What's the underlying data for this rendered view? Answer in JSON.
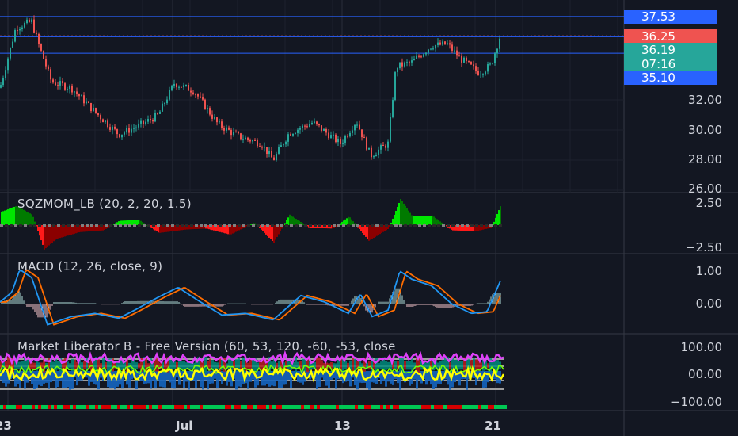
{
  "panes": {
    "price": {
      "axis_labels": [
        "32.00",
        "30.00",
        "28.00",
        "26.00"
      ],
      "tags": [
        {
          "name": "price-tag-high-line",
          "label": "37.53",
          "color": "#2962ff",
          "value": 37.53
        },
        {
          "name": "price-tag-last",
          "label": "36.25",
          "color": "#ef5350",
          "value": 36.25
        },
        {
          "name": "price-tag-line-2",
          "label": "36.19",
          "color": "#26a69a",
          "value": 36.19
        },
        {
          "name": "price-tag-countdown",
          "label": "07:16",
          "color": "#26a69a",
          "value": null
        },
        {
          "name": "price-tag-low-line",
          "label": "35.10",
          "color": "#2962ff",
          "value": 35.1
        }
      ]
    },
    "sqzmom": {
      "title": "SQZMOM_LB (20, 2, 20, 1.5)",
      "axis_labels": [
        "2.50",
        "−2.50"
      ]
    },
    "macd": {
      "title": "MACD (12, 26, close, 9)",
      "axis_labels": [
        "1.00",
        "0.00"
      ]
    },
    "liberator": {
      "title": "Market Liberator B - Free Version (60, 53, 120, -60, -53, close",
      "axis_labels": [
        "100.00",
        "00.00",
        "−100.00"
      ]
    }
  },
  "time_axis": [
    "23",
    "Jul",
    "13",
    "21"
  ],
  "colors": {
    "up": "#26a69a",
    "down": "#ef5350",
    "macd": "#2196f3",
    "signal": "#ff6d00",
    "grid": "#2a2e39",
    "bg": "#131722"
  }
}
